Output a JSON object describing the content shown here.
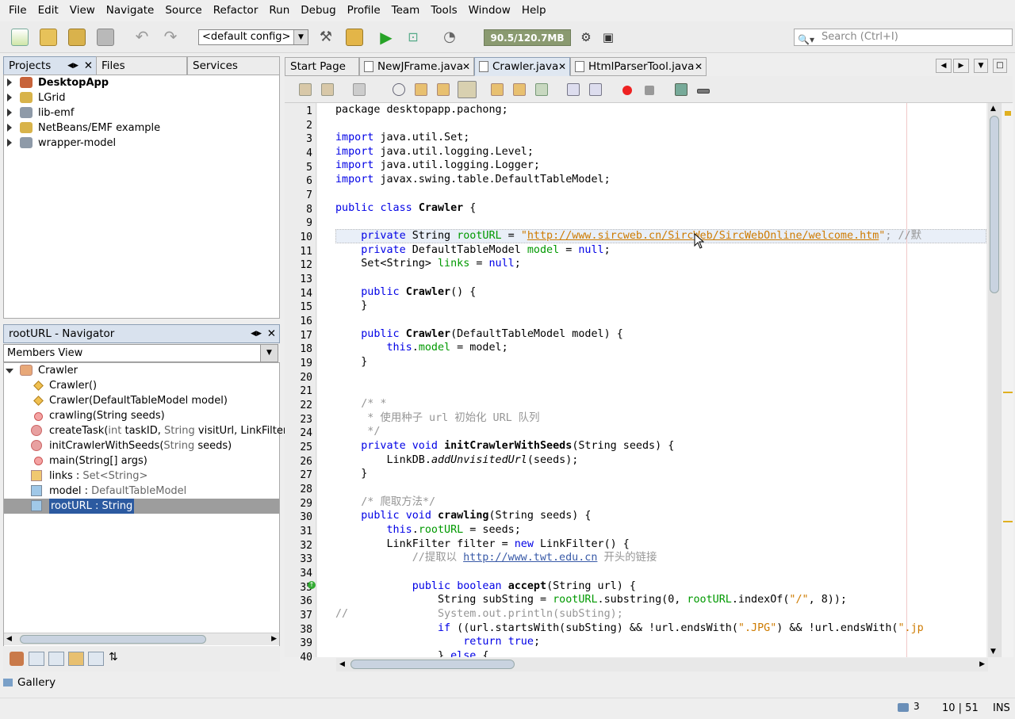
{
  "menu": [
    "File",
    "Edit",
    "View",
    "Navigate",
    "Source",
    "Refactor",
    "Run",
    "Debug",
    "Profile",
    "Team",
    "Tools",
    "Window",
    "Help"
  ],
  "toolbar": {
    "config": "<default config>",
    "memory": "90.5/120.7MB",
    "search_placeholder": "Search (Ctrl+I)"
  },
  "projects_panel": {
    "tabs": [
      "Projects",
      "Files",
      "Services"
    ],
    "items": [
      "DesktopApp",
      "LGrid",
      "lib-emf",
      "NetBeans/EMF example",
      "wrapper-model"
    ]
  },
  "navigator": {
    "title": "rootURL - Navigator",
    "view": "Members View",
    "class_name": "Crawler",
    "members": [
      {
        "name": "Crawler()",
        "type": ""
      },
      {
        "name": "Crawler(",
        "param": "DefaultTableModel",
        "rest": " model)"
      },
      {
        "name": "crawling(",
        "param": "String",
        "rest": " seeds)"
      },
      {
        "name": "createTask(",
        "param": "int",
        "rest": " taskID, ",
        "param2": "String",
        "rest2": " visitUrl, LinkFilter"
      },
      {
        "name": "initCrawlerWithSeeds(",
        "param": "String",
        "rest": " seeds)"
      },
      {
        "name": "main(String[] args)"
      },
      {
        "name": "links : ",
        "type": "Set<String>"
      },
      {
        "name": "model : ",
        "type": "DefaultTableModel"
      },
      {
        "name": "rootURL : String"
      }
    ]
  },
  "editor_tabs": [
    "Start Page",
    "NewJFrame.java",
    "Crawler.java",
    "HtmlParserTool.java"
  ],
  "code": {
    "line_numbers": [
      "1",
      "2",
      "3",
      "4",
      "5",
      "6",
      "7",
      "8",
      "9",
      "10",
      "11",
      "12",
      "13",
      "14",
      "15",
      "16",
      "17",
      "18",
      "19",
      "20",
      "21",
      "22",
      "23",
      "24",
      "25",
      "26",
      "27",
      "28",
      "29",
      "30",
      "31",
      "32",
      "33",
      "34",
      "35",
      "36",
      "37",
      "38",
      "39",
      "40"
    ],
    "l1": "package desktopapp.pachong;",
    "l3": "java.util.Set;",
    "l4": "java.util.logging.Level;",
    "l5": "java.util.logging.Logger;",
    "l6": "javax.swing.table.DefaultTableModel;",
    "kw_import": "import",
    "l8_class": "Crawler",
    "l10_url": "http://www.sircweb.cn/SircWeb/SircWebOnline/welcome.htm",
    "l10_tail": "; //默",
    "l23": "     * 使用种子 url 初始化 URL 队列",
    "l25_method": "initCrawlerWithSeeds",
    "l26_call": "addUnvisitedUrl",
    "l29": "    /* 爬取方法*/",
    "l30_method": "crawling",
    "l33_a": "            //提取以 ",
    "l33_url": "http://www.twt.edu.cn",
    "l33_b": " 开头的链接",
    "l35_method": "accept",
    "l37": "//              System.out.println(subSting);"
  },
  "gallery": "Gallery",
  "status": {
    "notifications": "3",
    "position": "10 | 51",
    "mode": "INS"
  }
}
